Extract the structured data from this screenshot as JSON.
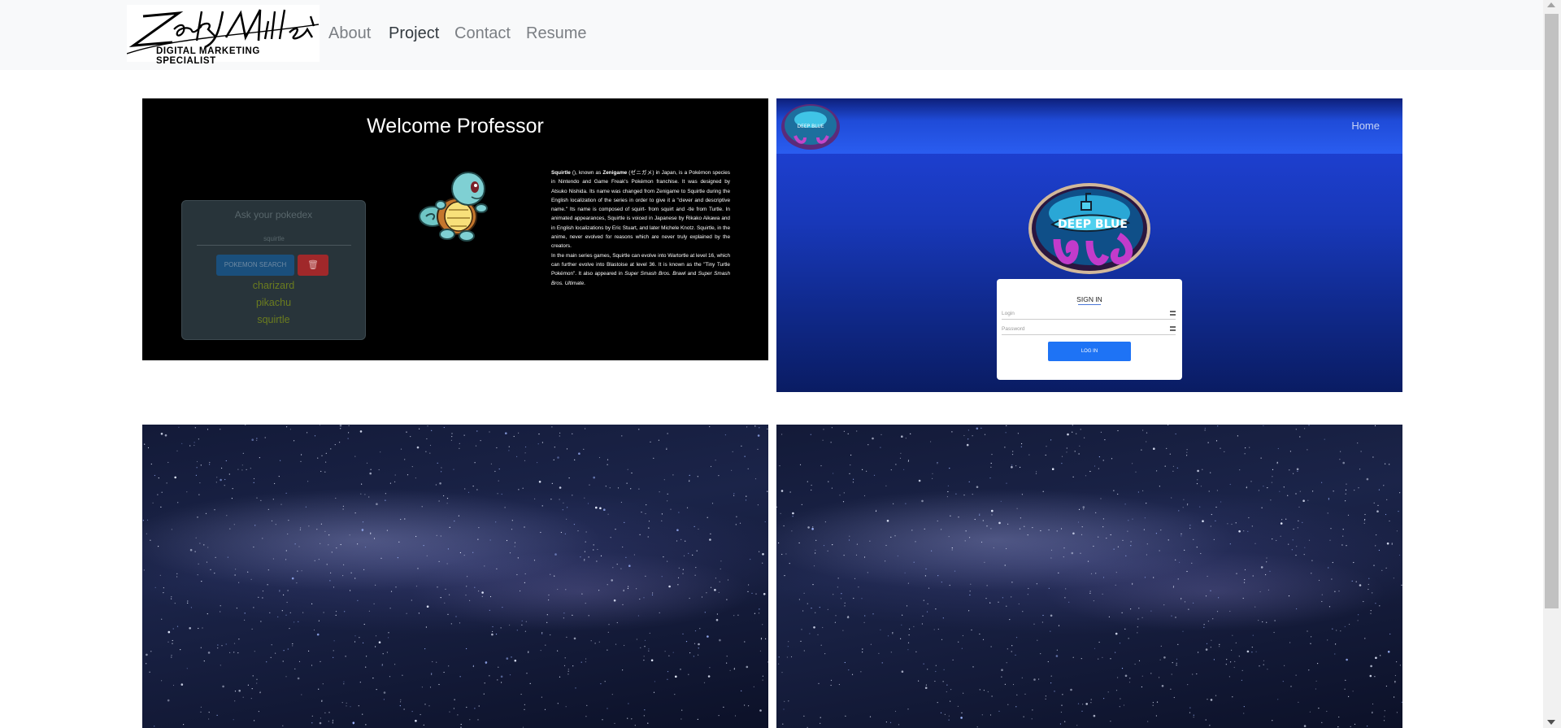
{
  "brand": {
    "logo_signature": "Zack Miller",
    "tagline": "DIGITAL MARKETING SPECIALIST"
  },
  "nav": {
    "items": [
      {
        "label": "About",
        "active": false
      },
      {
        "label": "Project",
        "active": true
      },
      {
        "label": "Contact",
        "active": false
      },
      {
        "label": "Resume",
        "active": false
      }
    ]
  },
  "projects": {
    "pokedex": {
      "title": "Welcome Professor",
      "panel_label": "Ask your pokedex",
      "search_value": "squirtle",
      "search_button": "POKEMON SEARCH",
      "delete_icon": "trash-icon",
      "history": [
        "charizard",
        "pikachu",
        "squirtle"
      ],
      "description_p1_bold1": "Squirtle",
      "description_p1_a": " (), known as ",
      "description_p1_bold2": "Zenigame",
      "description_p1_b": " (ゼニガメ) in Japan, is a Pokémon species in Nintendo and Game Freak's Pokémon franchise. It was designed by Atsuko Nishida. Its name was changed from Zenigame to Squirtle during the English localization of the series in order to give it a \"clever and descriptive name.\" Its name is composed of squirt- from squirt and -tle from Turtle. In animated appearances, Squirtle is voiced in Japanese by Rikako Aikawa and in English localizations by Eric Stuart, and later Michele Knotz. Squirtle, in the anime, never evolved for reasons which are never truly explained by the creators.",
      "description_p2_a": "In the main series games, Squirtle can evolve into Wartortle at level 16, which can further evolve into Blastoise at level 36. It is known as the \"Tiny Turtle Pokémon\". It also appeared in ",
      "description_p2_i1": "Super Smash Bros. Brawl",
      "description_p2_b": " and ",
      "description_p2_i2": "Super Smash Bros. Ultimate",
      "description_p2_c": "."
    },
    "deepblue": {
      "logo_text": "DEEP BLUE",
      "small_logo_text": "DEEP BLUE",
      "home_link": "Home",
      "signin_title": "SIGN IN",
      "login_placeholder": "Login",
      "password_placeholder": "Password",
      "login_button": "LOG IN"
    }
  },
  "colors": {
    "navbar_bg": "#f8f9fa",
    "nav_link": "#7b7f84",
    "nav_link_active": "#333a40",
    "deepblue_bg": "#1c45d7",
    "login_button": "#1e73f5"
  }
}
